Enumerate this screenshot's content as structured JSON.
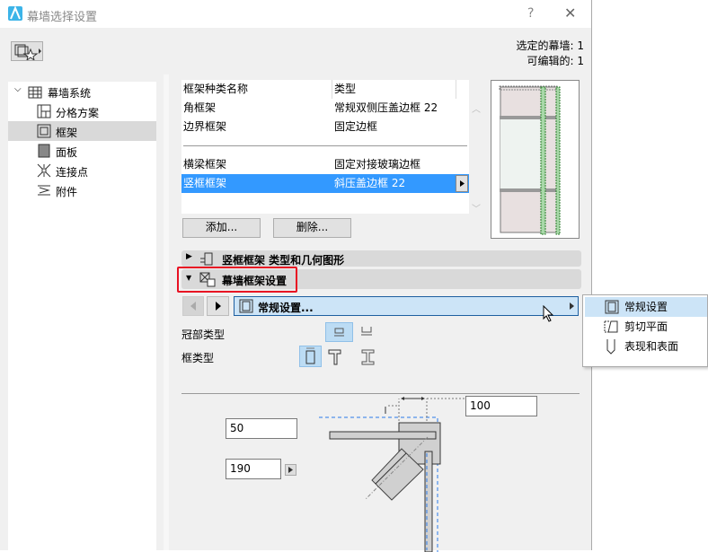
{
  "window": {
    "title": "幕墙选择设置",
    "help": "?",
    "close": "✕"
  },
  "info": {
    "selected": "选定的幕墙: 1",
    "editable": "可编辑的: 1"
  },
  "tree": {
    "root": "幕墙系统",
    "items": [
      {
        "label": "分格方案"
      },
      {
        "label": "框架",
        "selected": true
      },
      {
        "label": "面板"
      },
      {
        "label": "连接点"
      },
      {
        "label": "附件"
      }
    ]
  },
  "frame_table": {
    "headers": [
      "框架种类名称",
      "类型"
    ],
    "rows": [
      {
        "name": "角框架",
        "type": "常规双侧压盖边框 22"
      },
      {
        "name": "边界框架",
        "type": "固定边框"
      },
      {
        "name": "横梁框架",
        "type": "固定对接玻璃边框"
      },
      {
        "name": "竖框框架",
        "type": "斜压盖边框 22",
        "selected": true
      }
    ]
  },
  "buttons": {
    "add": "添加...",
    "delete": "删除..."
  },
  "sections": {
    "type_geometry": "竖框框架 类型和几何图形",
    "frame_settings": "幕墙框架设置"
  },
  "settings_nav": {
    "current": "常规设置..."
  },
  "popup_menu": {
    "items": [
      "常规设置",
      "剪切平面",
      "表现和表面"
    ]
  },
  "options": {
    "cap_type_label": "冠部类型",
    "frame_type_label": "框类型"
  },
  "fields": {
    "offset": "100",
    "depth": "50",
    "width": "190"
  },
  "colors": {
    "selection": "#3399ff",
    "accent_border": "#e81123",
    "dropdown": "#cce4f7"
  }
}
